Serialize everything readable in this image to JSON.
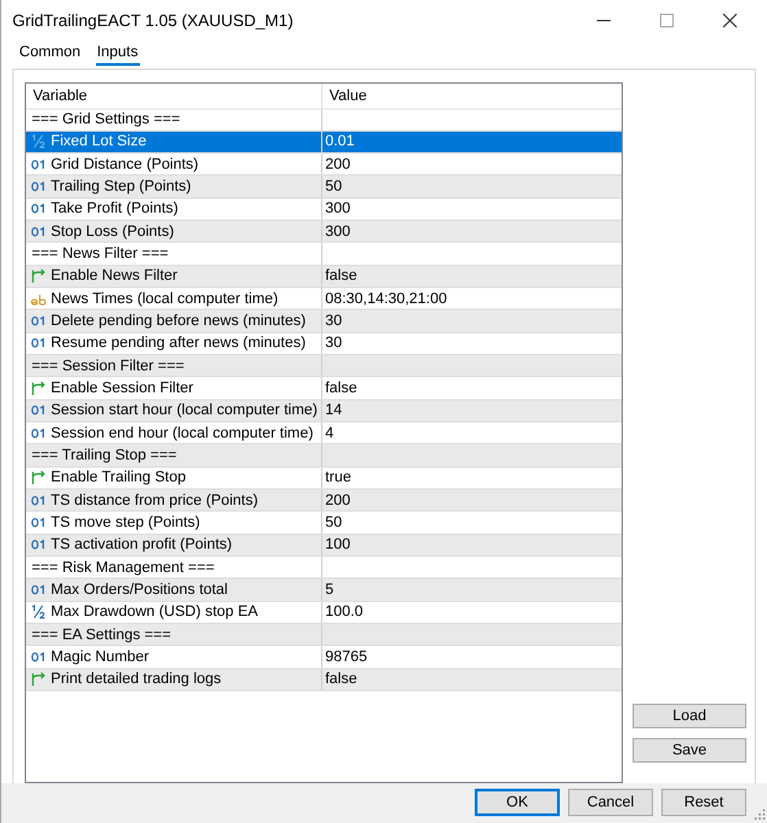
{
  "window": {
    "title": "GridTrailingEACT 1.05 (XAUUSD_M1)"
  },
  "tabs": [
    {
      "label": "Common",
      "selected": false
    },
    {
      "label": "Inputs",
      "selected": true
    }
  ],
  "table": {
    "columns": [
      "Variable",
      "Value"
    ],
    "rows": [
      {
        "kind": "section",
        "variable": "=== Grid Settings ===",
        "value": "",
        "selected": false
      },
      {
        "kind": "double",
        "variable": "Fixed Lot Size",
        "value": "0.01",
        "selected": true
      },
      {
        "kind": "int",
        "variable": "Grid Distance (Points)",
        "value": "200",
        "selected": false
      },
      {
        "kind": "int",
        "variable": "Trailing Step (Points)",
        "value": "50",
        "selected": false
      },
      {
        "kind": "int",
        "variable": "Take Profit (Points)",
        "value": "300",
        "selected": false
      },
      {
        "kind": "int",
        "variable": "Stop Loss (Points)",
        "value": "300",
        "selected": false
      },
      {
        "kind": "section",
        "variable": "=== News Filter ===",
        "value": "",
        "selected": false
      },
      {
        "kind": "bool",
        "variable": "Enable News Filter",
        "value": "false",
        "selected": false
      },
      {
        "kind": "string",
        "variable": "News Times (local computer time)",
        "value": "08:30,14:30,21:00",
        "selected": false
      },
      {
        "kind": "int",
        "variable": "Delete pending before news (minutes)",
        "value": "30",
        "selected": false
      },
      {
        "kind": "int",
        "variable": "Resume pending after news (minutes)",
        "value": "30",
        "selected": false
      },
      {
        "kind": "section",
        "variable": "=== Session Filter ===",
        "value": "",
        "selected": false
      },
      {
        "kind": "bool",
        "variable": "Enable Session Filter",
        "value": "false",
        "selected": false
      },
      {
        "kind": "int",
        "variable": "Session start hour (local computer time)",
        "value": "14",
        "selected": false
      },
      {
        "kind": "int",
        "variable": "Session end hour (local computer time)",
        "value": "4",
        "selected": false
      },
      {
        "kind": "section",
        "variable": "=== Trailing Stop ===",
        "value": "",
        "selected": false
      },
      {
        "kind": "bool",
        "variable": "Enable Trailing Stop",
        "value": "true",
        "selected": false
      },
      {
        "kind": "int",
        "variable": "TS distance from price (Points)",
        "value": "200",
        "selected": false
      },
      {
        "kind": "int",
        "variable": "TS move step (Points)",
        "value": "50",
        "selected": false
      },
      {
        "kind": "int",
        "variable": "TS activation profit (Points)",
        "value": "100",
        "selected": false
      },
      {
        "kind": "section",
        "variable": "=== Risk Management ===",
        "value": "",
        "selected": false
      },
      {
        "kind": "int",
        "variable": "Max Orders/Positions total",
        "value": "5",
        "selected": false
      },
      {
        "kind": "double",
        "variable": "Max Drawdown (USD) stop EA",
        "value": "100.0",
        "selected": false
      },
      {
        "kind": "section",
        "variable": "=== EA Settings ===",
        "value": "",
        "selected": false
      },
      {
        "kind": "int",
        "variable": "Magic Number",
        "value": "98765",
        "selected": false
      },
      {
        "kind": "bool",
        "variable": "Print detailed trading logs",
        "value": "false",
        "selected": false
      }
    ]
  },
  "side_buttons": [
    "Load",
    "Save"
  ],
  "buttons": [
    {
      "label": "OK",
      "default": true
    },
    {
      "label": "Cancel",
      "default": false
    },
    {
      "label": "Reset",
      "default": false
    }
  ]
}
